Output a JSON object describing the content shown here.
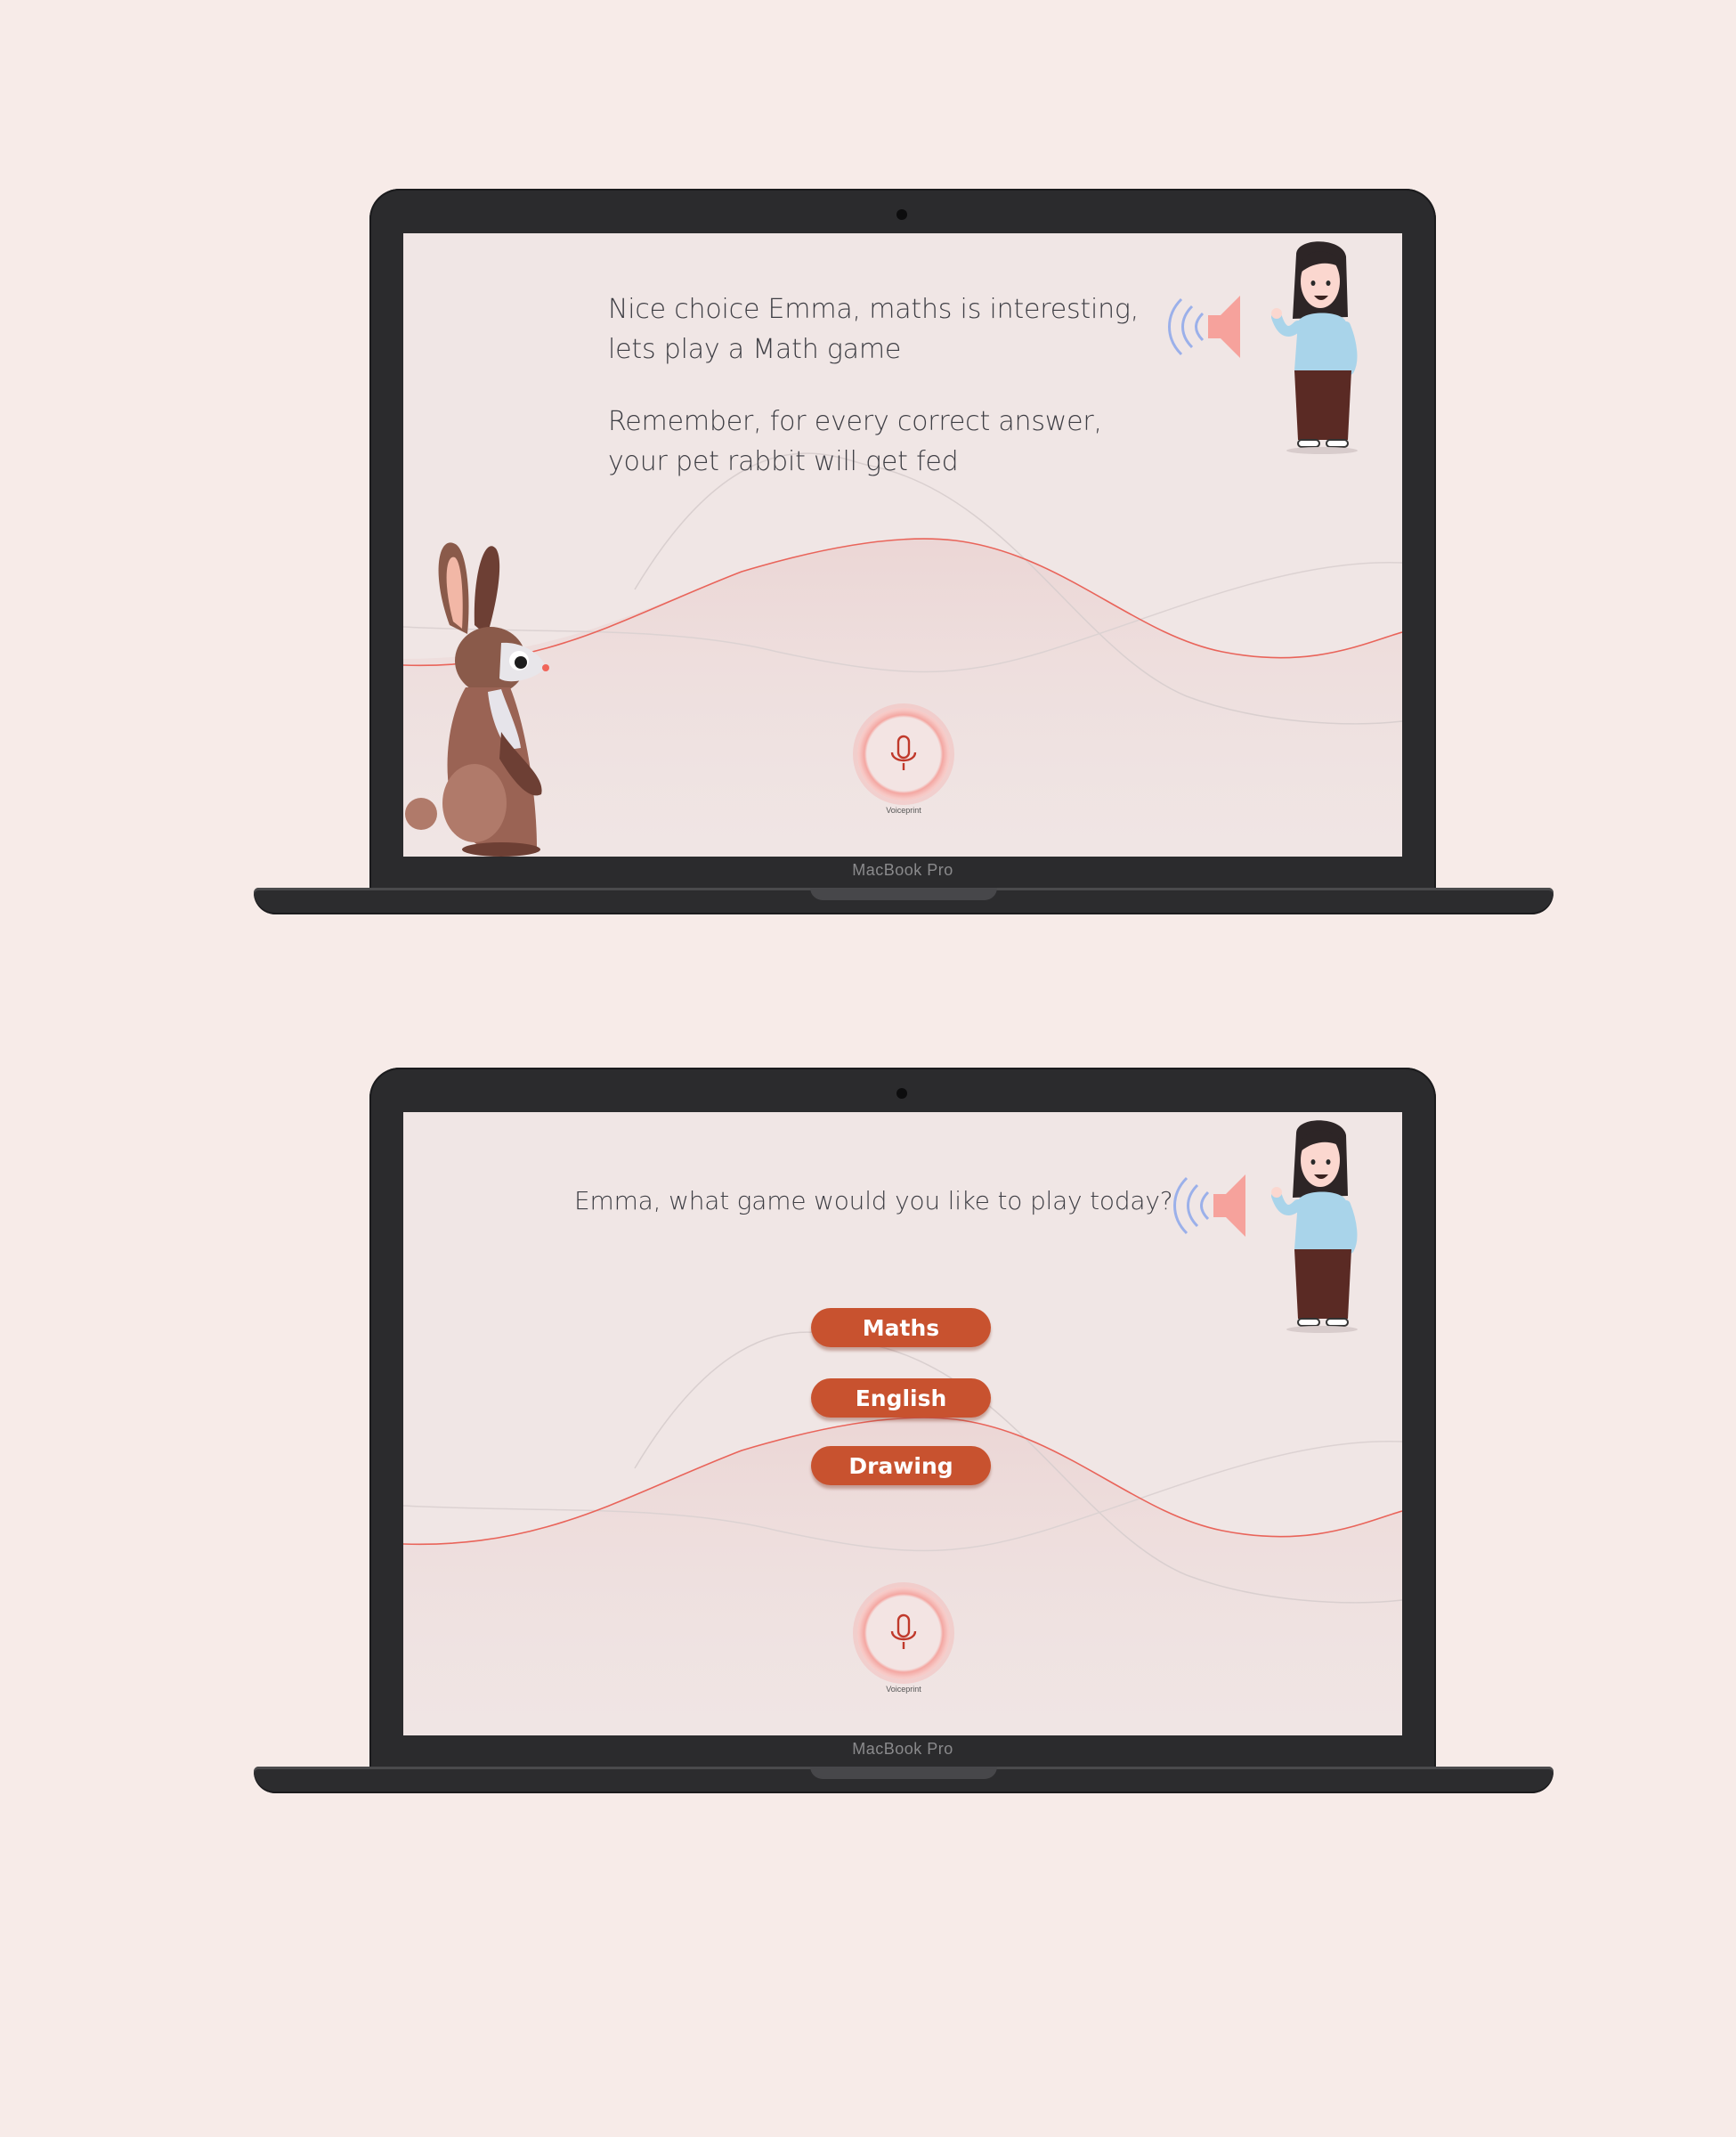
{
  "colors": {
    "page_bg": "#f7ebe8",
    "screen_bg": "#f0e6e5",
    "accent": "#c8522f",
    "wave": "#e9645a",
    "text": "#3e3e44"
  },
  "device_label": "MacBook Pro",
  "screens": [
    {
      "prompt_lines": [
        "Nice choice Emma, maths is interesting,",
        "lets play a Math game",
        "Remember, for every correct answer,",
        "your pet rabbit will get fed"
      ],
      "mic_label": "Voiceprint",
      "speaker_icon": "speaker-icon",
      "mic_icon": "microphone-icon"
    },
    {
      "prompt": "Emma, what game would you like to play today?",
      "choices": [
        "Maths",
        "English",
        "Drawing"
      ],
      "mic_label": "Voiceprint",
      "speaker_icon": "speaker-icon",
      "mic_icon": "microphone-icon"
    }
  ]
}
